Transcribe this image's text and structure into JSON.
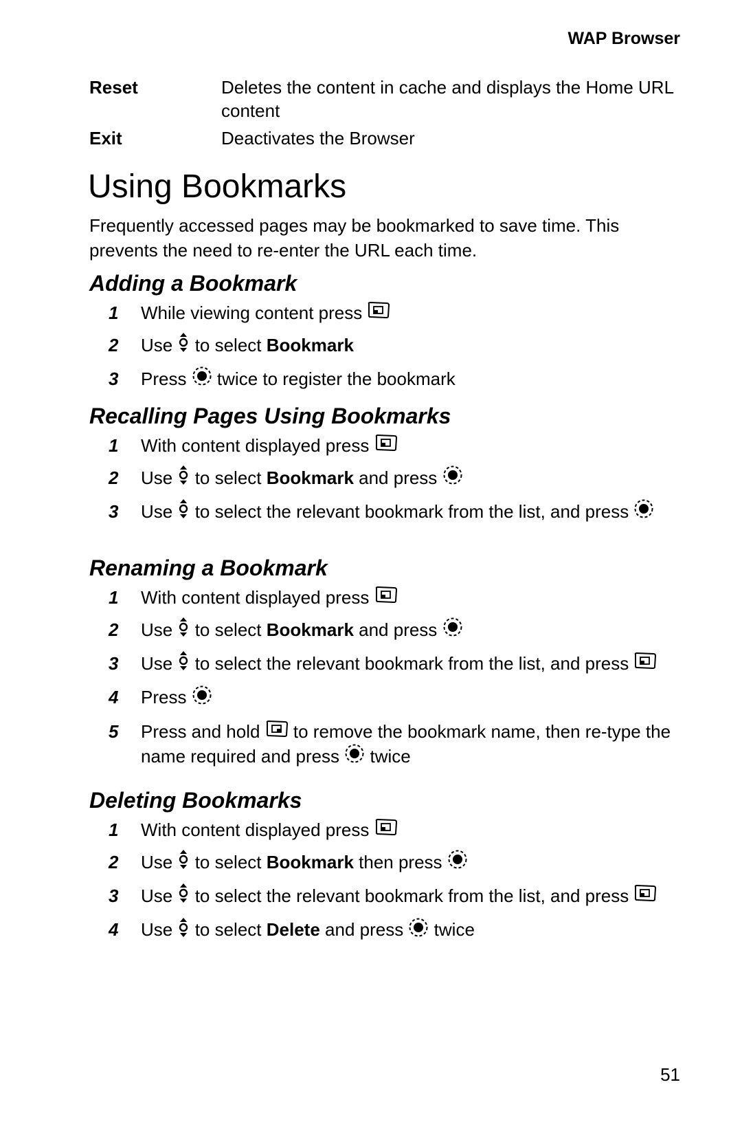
{
  "header": {
    "running_title": "WAP Browser"
  },
  "options": [
    {
      "term": "Reset",
      "desc": "Deletes the content in cache and displays the Home URL content"
    },
    {
      "term": "Exit",
      "desc": "Deactivates the Browser"
    }
  ],
  "title": "Using Bookmarks",
  "intro": "Frequently accessed pages may be bookmarked to save time. This prevents the need to re-enter the URL each time.",
  "sections": [
    {
      "heading": "Adding a Bookmark",
      "steps": [
        {
          "num": "1",
          "parts": [
            {
              "t": "text",
              "v": "While viewing content press "
            },
            {
              "t": "icon",
              "v": "left-soft-key-icon"
            }
          ]
        },
        {
          "num": "2",
          "parts": [
            {
              "t": "text",
              "v": "Use "
            },
            {
              "t": "icon",
              "v": "navigation-key-icon"
            },
            {
              "t": "text",
              "v": " to select "
            },
            {
              "t": "bold",
              "v": "Bookmark"
            }
          ]
        },
        {
          "num": "3",
          "parts": [
            {
              "t": "text",
              "v": "Press "
            },
            {
              "t": "icon",
              "v": "select-key-icon"
            },
            {
              "t": "text",
              "v": " twice to register the bookmark"
            }
          ]
        }
      ]
    },
    {
      "heading": "Recalling Pages Using Bookmarks",
      "steps": [
        {
          "num": "1",
          "parts": [
            {
              "t": "text",
              "v": "With content displayed press "
            },
            {
              "t": "icon",
              "v": "left-soft-key-icon"
            }
          ]
        },
        {
          "num": "2",
          "parts": [
            {
              "t": "text",
              "v": "Use "
            },
            {
              "t": "icon",
              "v": "navigation-key-icon"
            },
            {
              "t": "text",
              "v": " to select "
            },
            {
              "t": "bold",
              "v": "Bookmark"
            },
            {
              "t": "text",
              "v": " and press "
            },
            {
              "t": "icon",
              "v": "select-key-icon"
            }
          ]
        },
        {
          "num": "3",
          "parts": [
            {
              "t": "text",
              "v": "Use "
            },
            {
              "t": "icon",
              "v": "navigation-key-icon"
            },
            {
              "t": "text",
              "v": " to select the relevant bookmark from the list, and press "
            },
            {
              "t": "icon",
              "v": "select-key-icon"
            }
          ]
        }
      ]
    },
    {
      "heading": "Renaming a Bookmark",
      "steps": [
        {
          "num": "1",
          "parts": [
            {
              "t": "text",
              "v": "With content displayed press "
            },
            {
              "t": "icon",
              "v": "left-soft-key-icon"
            }
          ]
        },
        {
          "num": "2",
          "parts": [
            {
              "t": "text",
              "v": "Use "
            },
            {
              "t": "icon",
              "v": "navigation-key-icon"
            },
            {
              "t": "text",
              "v": " to select "
            },
            {
              "t": "bold",
              "v": "Bookmark"
            },
            {
              "t": "text",
              "v": " and press "
            },
            {
              "t": "icon",
              "v": "select-key-icon"
            }
          ]
        },
        {
          "num": "3",
          "parts": [
            {
              "t": "text",
              "v": "Use "
            },
            {
              "t": "icon",
              "v": "navigation-key-icon"
            },
            {
              "t": "text",
              "v": " to select the relevant bookmark from the list, and press "
            },
            {
              "t": "icon",
              "v": "left-soft-key-icon"
            }
          ]
        },
        {
          "num": "4",
          "parts": [
            {
              "t": "text",
              "v": "Press "
            },
            {
              "t": "icon",
              "v": "select-key-icon"
            }
          ]
        },
        {
          "num": "5",
          "parts": [
            {
              "t": "text",
              "v": "Press and hold "
            },
            {
              "t": "icon",
              "v": "clear-key-icon"
            },
            {
              "t": "text",
              "v": " to remove the bookmark name, then re-type the name required and press "
            },
            {
              "t": "icon",
              "v": "select-key-icon"
            },
            {
              "t": "text",
              "v": " twice"
            }
          ]
        }
      ]
    },
    {
      "heading": "Deleting Bookmarks",
      "steps": [
        {
          "num": "1",
          "parts": [
            {
              "t": "text",
              "v": "With content displayed press "
            },
            {
              "t": "icon",
              "v": "left-soft-key-icon"
            }
          ]
        },
        {
          "num": "2",
          "parts": [
            {
              "t": "text",
              "v": "Use "
            },
            {
              "t": "icon",
              "v": "navigation-key-icon"
            },
            {
              "t": "text",
              "v": " to select "
            },
            {
              "t": "bold",
              "v": "Bookmark"
            },
            {
              "t": "text",
              "v": " then press "
            },
            {
              "t": "icon",
              "v": "select-key-icon"
            }
          ]
        },
        {
          "num": "3",
          "parts": [
            {
              "t": "text",
              "v": "Use "
            },
            {
              "t": "icon",
              "v": "navigation-key-icon"
            },
            {
              "t": "text",
              "v": " to select the relevant bookmark from the list, and press "
            },
            {
              "t": "icon",
              "v": "left-soft-key-icon"
            }
          ]
        },
        {
          "num": "4",
          "parts": [
            {
              "t": "text",
              "v": "Use "
            },
            {
              "t": "icon",
              "v": "navigation-key-icon"
            },
            {
              "t": "text",
              "v": " to select "
            },
            {
              "t": "bold",
              "v": "Delete"
            },
            {
              "t": "text",
              "v": " and press "
            },
            {
              "t": "icon",
              "v": "select-key-icon"
            },
            {
              "t": "text",
              "v": " twice"
            }
          ]
        }
      ]
    }
  ],
  "footer": {
    "page_number": "51"
  }
}
